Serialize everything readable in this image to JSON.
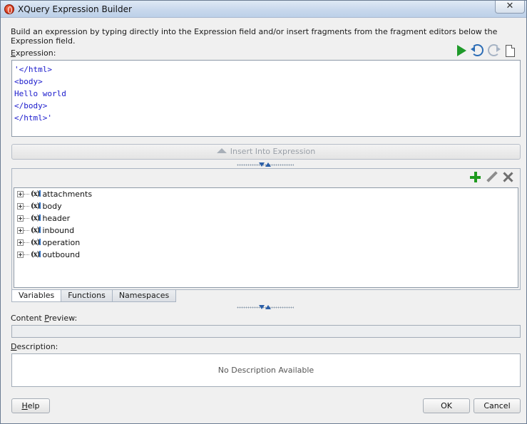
{
  "window": {
    "title": "XQuery Expression Builder",
    "close_glyph": "✕"
  },
  "instructions": "Build an expression by typing directly into the Expression field and/or insert fragments from the fragment editors below the Expression field.",
  "expression": {
    "label_mnemonic": "E",
    "label_rest": "xpression:",
    "value": "'</html>\n<body>\nHello world\n</body>\n</html>'",
    "toolbar_icons": [
      "play-icon",
      "undo-icon",
      "redo-icon",
      "new-document-icon"
    ]
  },
  "insert_button": {
    "label": "Insert Into Expression",
    "icon": "up-arrow-icon"
  },
  "fragments": {
    "toolbar_icons": [
      "plus-icon",
      "pencil-icon",
      "x-icon"
    ],
    "tree_items": [
      {
        "label": "attachments",
        "icon": "variable-icon"
      },
      {
        "label": "body",
        "icon": "variable-icon"
      },
      {
        "label": "header",
        "icon": "variable-icon"
      },
      {
        "label": "inbound",
        "icon": "variable-icon"
      },
      {
        "label": "operation",
        "icon": "variable-icon"
      },
      {
        "label": "outbound",
        "icon": "variable-icon"
      }
    ],
    "var_icon_glyph": "(x)"
  },
  "tabs": [
    {
      "label": "Variables",
      "active": true
    },
    {
      "label": "Functions",
      "active": false
    },
    {
      "label": "Namespaces",
      "active": false
    }
  ],
  "content_preview": {
    "label_before": "Content ",
    "label_mnemonic": "P",
    "label_after": "review:",
    "value": ""
  },
  "description": {
    "label_mnemonic": "D",
    "label_rest": "escription:",
    "value": "No Description Available"
  },
  "buttons": {
    "help_mnemonic": "H",
    "help_rest": "elp",
    "ok": "OK",
    "cancel": "Cancel"
  },
  "colors": {
    "expression_text": "#1a1acc",
    "run_green": "#1f9a2a",
    "add_green": "#1e9a1e"
  }
}
